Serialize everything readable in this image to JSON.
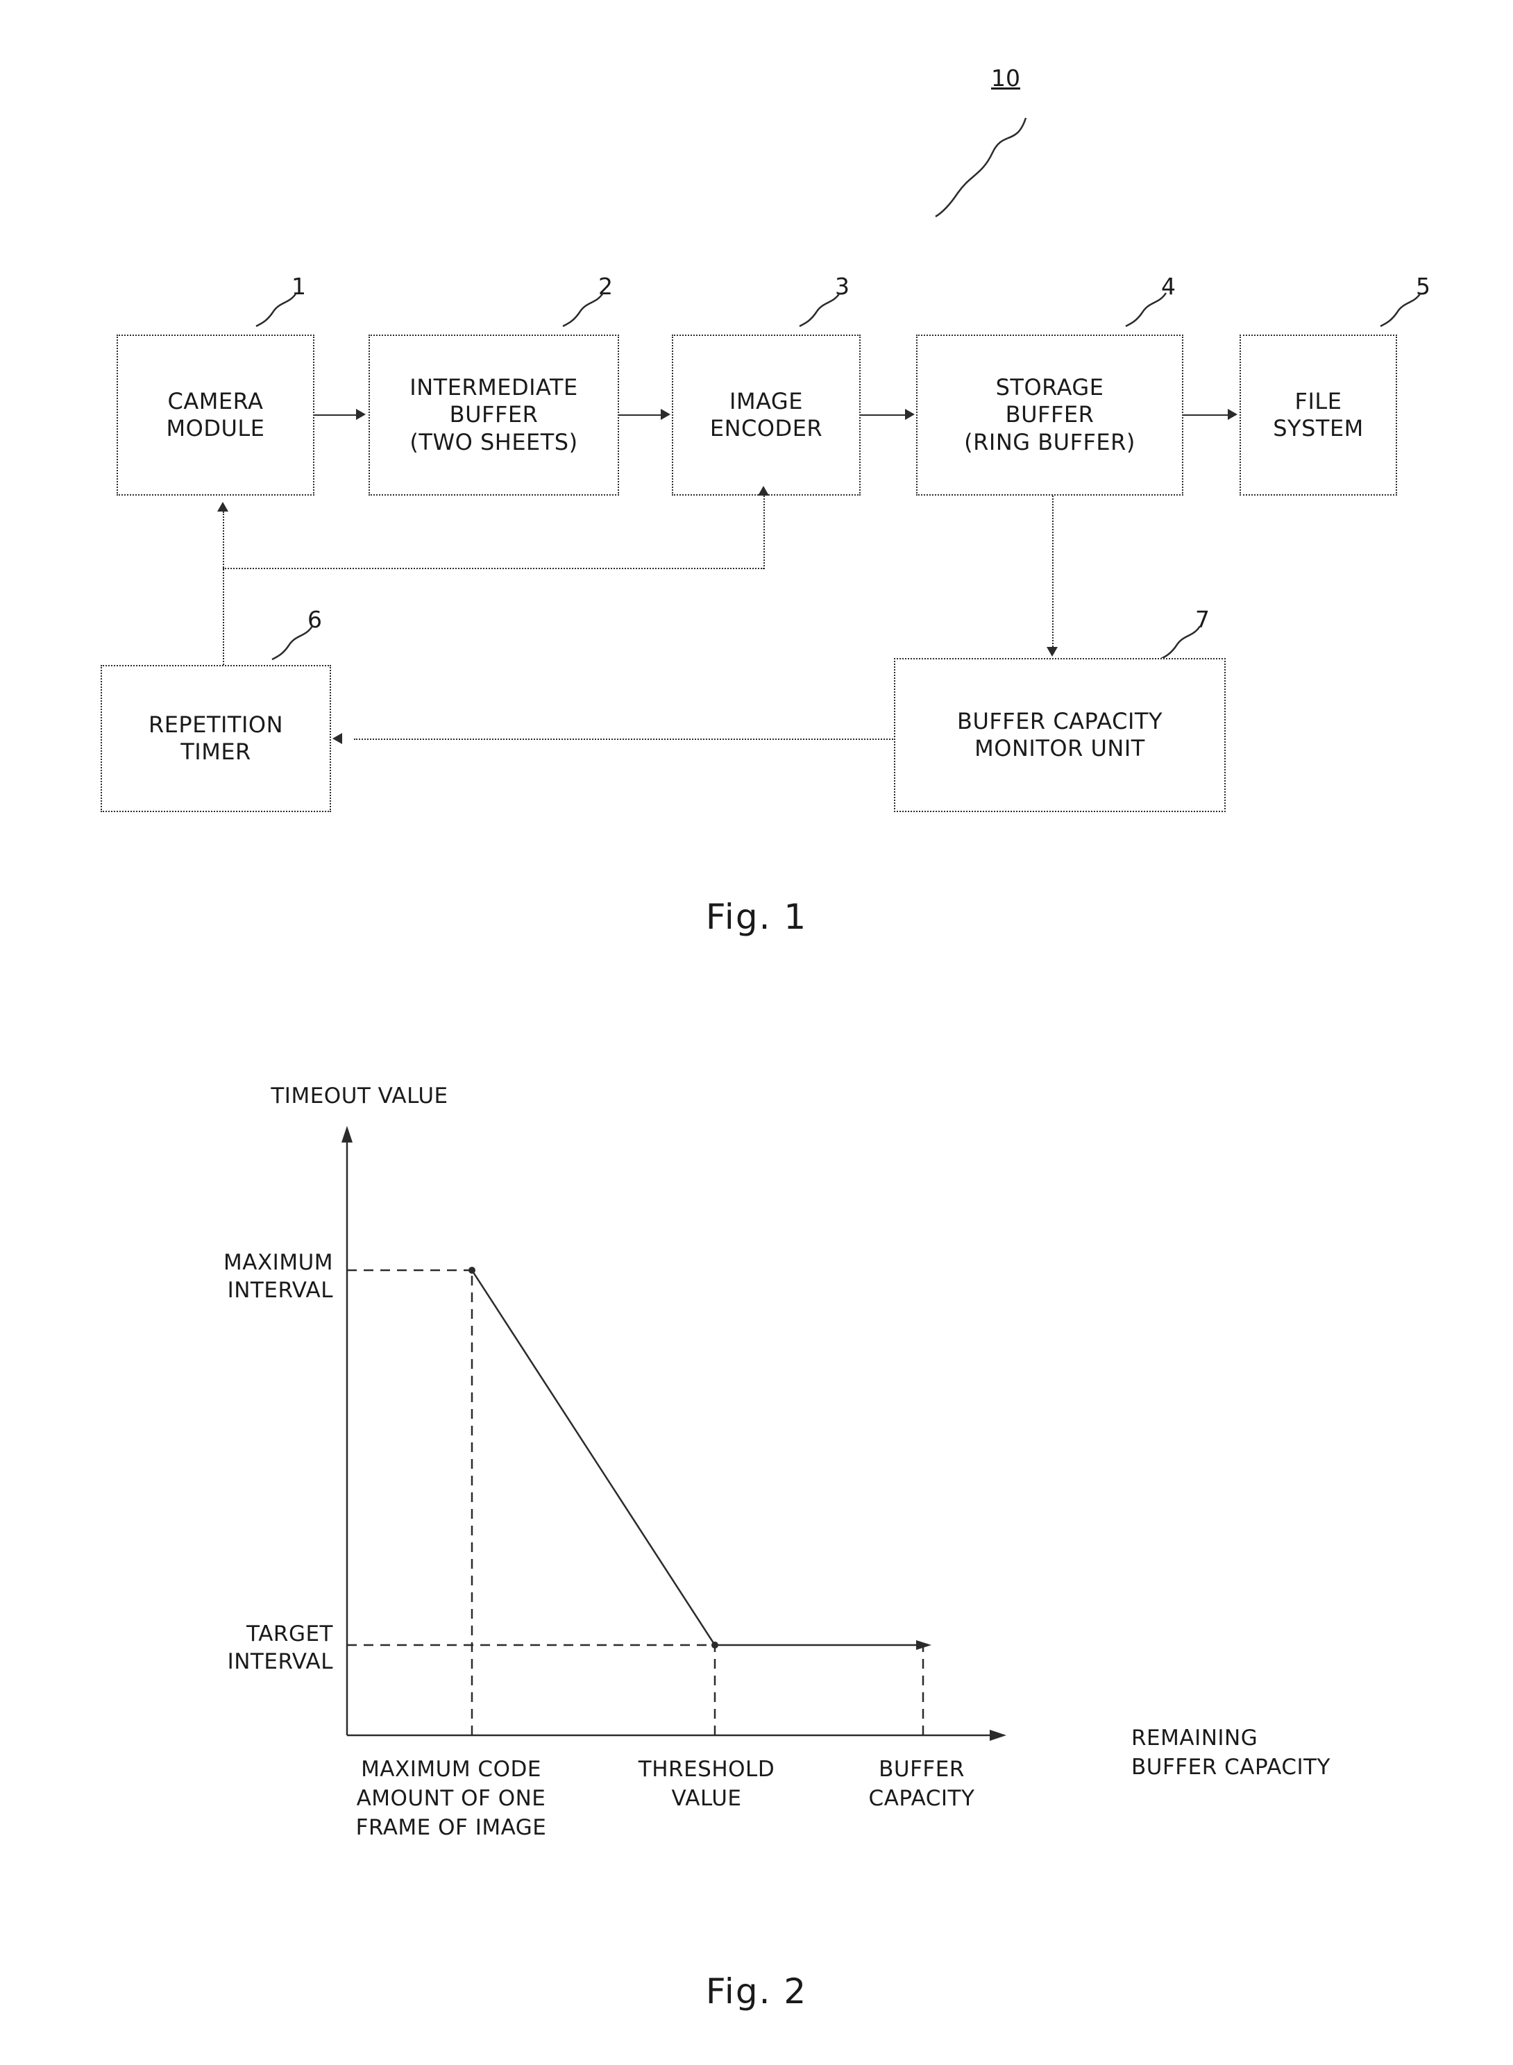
{
  "figure1": {
    "ref_top": "10",
    "caption": "Fig. 1",
    "nodes": [
      {
        "id": "camera-module",
        "ref": "1",
        "lines": [
          "CAMERA",
          "MODULE"
        ]
      },
      {
        "id": "intermediate-buffer",
        "ref": "2",
        "lines": [
          "INTERMEDIATE",
          "BUFFER",
          "(TWO SHEETS)"
        ]
      },
      {
        "id": "image-encoder",
        "ref": "3",
        "lines": [
          "IMAGE",
          "ENCODER"
        ]
      },
      {
        "id": "storage-buffer",
        "ref": "4",
        "lines": [
          "STORAGE",
          "BUFFER",
          "(RING BUFFER)"
        ]
      },
      {
        "id": "file-system",
        "ref": "5",
        "lines": [
          "FILE",
          "SYSTEM"
        ]
      },
      {
        "id": "repetition-timer",
        "ref": "6",
        "lines": [
          "REPETITION",
          "TIMER"
        ]
      },
      {
        "id": "buffer-capacity-monitor-unit",
        "ref": "7",
        "lines": [
          "BUFFER CAPACITY",
          "MONITOR UNIT"
        ]
      }
    ]
  },
  "figure2": {
    "caption": "Fig. 2",
    "chart_data": {
      "type": "line",
      "title": "",
      "ylabel": "TIMEOUT VALUE",
      "xlabel": "REMAINING\nBUFFER CAPACITY",
      "xlabel_lines": [
        "REMAINING",
        "BUFFER CAPACITY"
      ],
      "y_ticks": [
        {
          "label_lines": [
            "MAXIMUM",
            "INTERVAL"
          ],
          "value": "MAXIMUM INTERVAL"
        },
        {
          "label_lines": [
            "TARGET",
            "INTERVAL"
          ],
          "value": "TARGET INTERVAL"
        }
      ],
      "x_ticks": [
        {
          "label_lines": [
            "MAXIMUM CODE",
            "AMOUNT OF ONE",
            "FRAME OF IMAGE"
          ],
          "value": "MAXIMUM CODE AMOUNT OF ONE FRAME OF IMAGE"
        },
        {
          "label_lines": [
            "THRESHOLD",
            "VALUE"
          ],
          "value": "THRESHOLD VALUE"
        },
        {
          "label_lines": [
            "BUFFER",
            "CAPACITY"
          ],
          "value": "BUFFER CAPACITY"
        }
      ],
      "x": [
        "MAXIMUM CODE AMOUNT OF ONE FRAME OF IMAGE",
        "THRESHOLD VALUE",
        "BUFFER CAPACITY"
      ],
      "values": [
        "MAXIMUM INTERVAL",
        "TARGET INTERVAL",
        "TARGET INTERVAL"
      ],
      "series": [
        {
          "name": "timeout value",
          "points": [
            {
              "x": "MAXIMUM CODE AMOUNT OF ONE FRAME OF IMAGE",
              "y": "MAXIMUM INTERVAL"
            },
            {
              "x": "THRESHOLD VALUE",
              "y": "TARGET INTERVAL"
            },
            {
              "x": "BUFFER CAPACITY",
              "y": "TARGET INTERVAL"
            }
          ]
        }
      ],
      "grid": false,
      "legend": false
    }
  }
}
